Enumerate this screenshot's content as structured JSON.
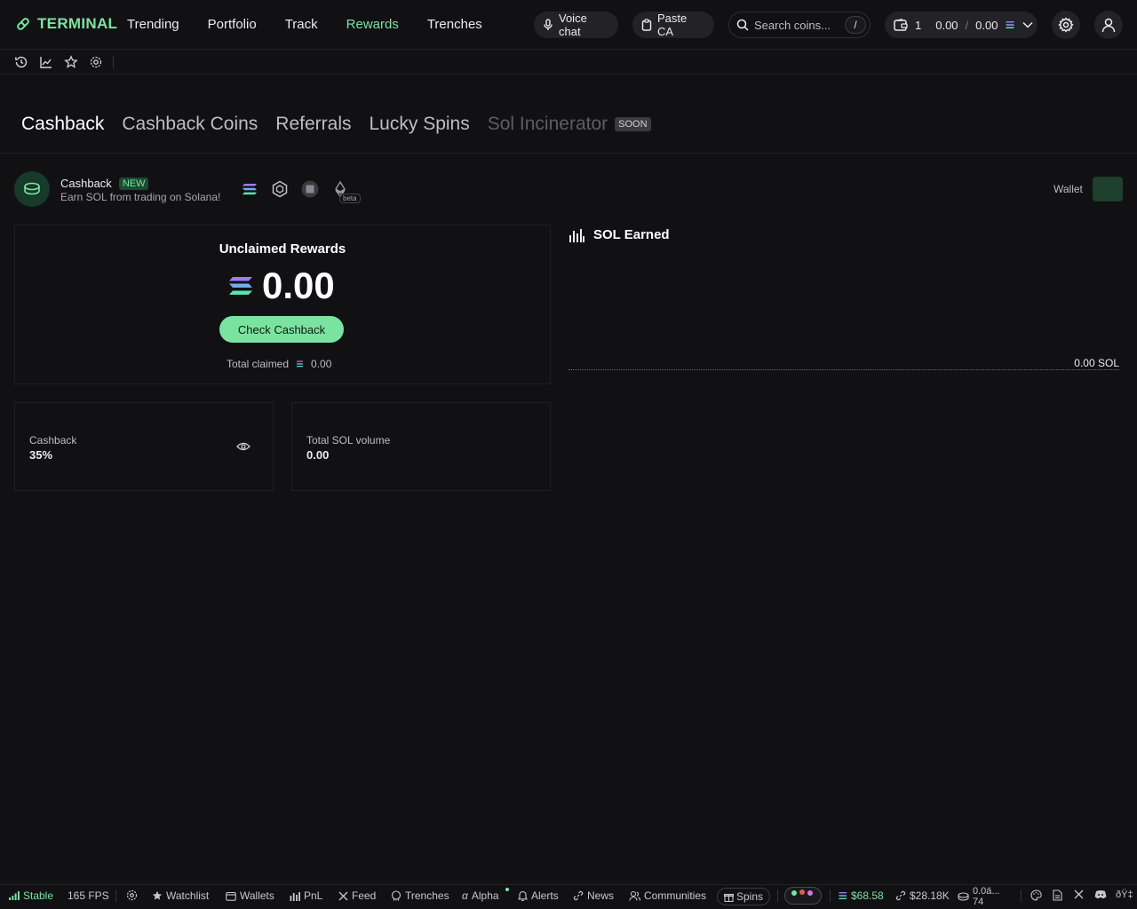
{
  "header": {
    "logo_text": "TERMINAL",
    "nav": [
      {
        "label": "Trending",
        "active": false
      },
      {
        "label": "Portfolio",
        "active": false
      },
      {
        "label": "Track",
        "active": false
      },
      {
        "label": "Rewards",
        "active": true
      },
      {
        "label": "Trenches",
        "active": false
      }
    ],
    "voice_chat": "Voice chat",
    "paste_ca": "Paste CA",
    "search_placeholder": "Search coins...",
    "search_shortcut": "/",
    "wallet_count": "1",
    "wallet_balance": "0.00",
    "wallet_slash": "/",
    "wallet_sol": "0.00"
  },
  "tabs": [
    {
      "label": "Cashback",
      "state": "active"
    },
    {
      "label": "Cashback Coins",
      "state": "normal"
    },
    {
      "label": "Referrals",
      "state": "normal"
    },
    {
      "label": "Lucky Spins",
      "state": "normal"
    },
    {
      "label": "Sol Incinerator",
      "state": "disabled"
    }
  ],
  "soon_badge": "SOON",
  "cashback_section": {
    "title": "Cashback",
    "badge": "NEW",
    "subtitle": "Earn SOL from trading on Solana!",
    "beta": "beta",
    "wallet_label": "Wallet"
  },
  "rewards": {
    "title": "Unclaimed Rewards",
    "amount": "0.00",
    "button": "Check Cashback",
    "claimed_label": "Total claimed",
    "claimed_value": "0.00"
  },
  "stats": [
    {
      "label": "Cashback",
      "value": "35%"
    },
    {
      "label": "Total SOL volume",
      "value": "0.00"
    }
  ],
  "sol_earned": {
    "title": "SOL Earned",
    "value": "0.00 SOL"
  },
  "footer": {
    "stable": "Stable",
    "fps": "165 FPS",
    "watchlist": "Watchlist",
    "wallets": "Wallets",
    "pnl": "PnL",
    "feed": "Feed",
    "trenches": "Trenches",
    "alpha": "Alpha",
    "alerts": "Alerts",
    "news": "News",
    "communities": "Communities",
    "spins": "Spins",
    "sol_price": "$68.58",
    "link_value": "$28.18K",
    "coin_value": "0.0ä...",
    "coin_value_sub": "74",
    "garbled": "ðŸ‡"
  },
  "colors": {
    "accent": "#7be3a0",
    "background": "#111114",
    "border": "#222226"
  }
}
